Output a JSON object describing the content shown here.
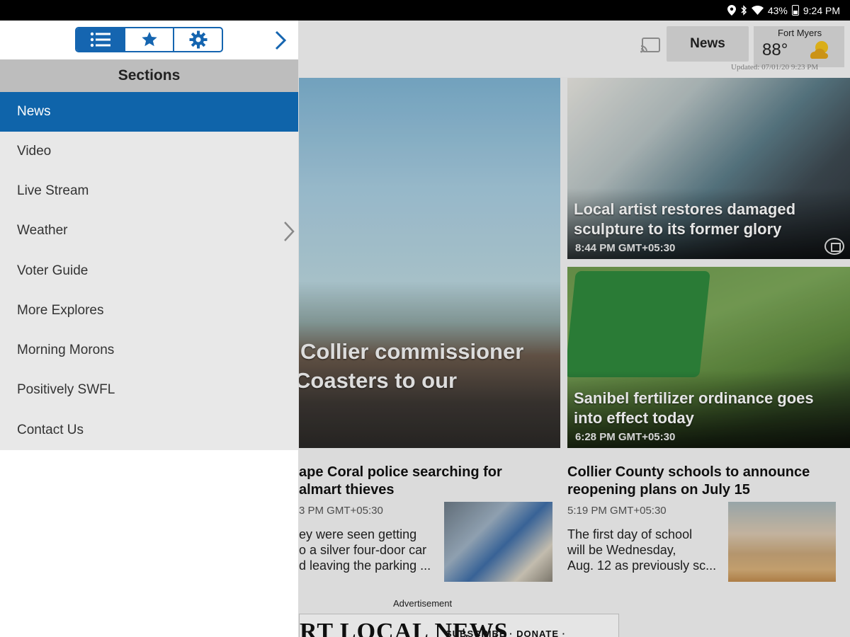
{
  "status_bar": {
    "battery": "43%",
    "time": "9:24 PM",
    "icons": [
      "location-icon",
      "bluetooth-icon",
      "wifi-icon",
      "battery-icon"
    ]
  },
  "header": {
    "news_button": "News",
    "weather": {
      "city": "Fort Myers",
      "temp": "88°",
      "updated": "Updated: 07/01/20 9:23 PM"
    }
  },
  "drawer": {
    "tabs": [
      "sections-list-icon",
      "favorites-star-icon",
      "settings-gear-icon"
    ],
    "section_title": "Sections",
    "items": [
      {
        "label": "News",
        "active": true
      },
      {
        "label": "Video"
      },
      {
        "label": "Live Stream"
      },
      {
        "label": "Weather",
        "has_submenu": true
      },
      {
        "label": "Voter Guide"
      },
      {
        "label": "More Explores"
      },
      {
        "label": "Morning Morons"
      },
      {
        "label": "Positively SWFL"
      },
      {
        "label": "Contact Us"
      }
    ],
    "accent": "#0f64aa"
  },
  "stories": {
    "hero": {
      "title_line1": "Collier commissioner",
      "title_line2": "Coasters to our"
    },
    "artist": {
      "title": "Local artist restores damaged sculpture to its former glory",
      "time": "8:44 PM GMT+05:30"
    },
    "fertilizer": {
      "title": "Sanibel fertilizer ordinance goes into effect today",
      "time": "6:28 PM GMT+05:30"
    },
    "cape": {
      "title_line1": "ape Coral police searching for",
      "title_line2": "almart thieves",
      "time": "3 PM GMT+05:30",
      "body_line1": "ey were seen getting",
      "body_line2": "o a silver four-door car",
      "body_line3": "d leaving the parking ..."
    },
    "collier": {
      "title_line1": "Collier County schools to announce",
      "title_line2": "reopening plans on July 15",
      "time": "5:19 PM GMT+05:30",
      "body_line1": "The first day of school",
      "body_line2": "will be Wednesday,",
      "body_line3": "Aug. 12 as previously sc..."
    }
  },
  "ad": {
    "label": "Advertisement",
    "headline": "RT LOCAL NEWS",
    "tagline": "SUBSCRIBE · DONATE · ADVERTISE"
  }
}
